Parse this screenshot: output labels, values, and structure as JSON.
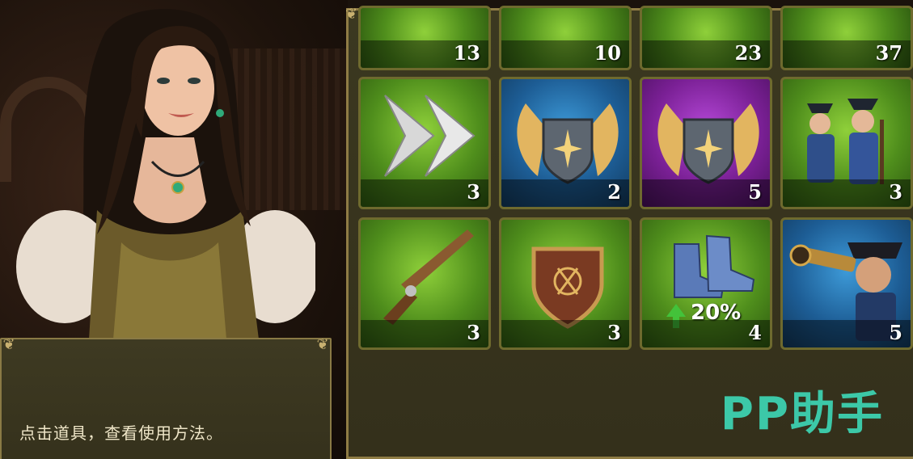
{
  "dialog": {
    "text": "点击道具，查看使用方法。"
  },
  "watermark": {
    "text": "PP助手"
  },
  "inventory": {
    "row1": [
      {
        "icon": "item-icon",
        "count": "13"
      },
      {
        "icon": "item-icon",
        "count": "10"
      },
      {
        "icon": "item-icon",
        "count": "23"
      },
      {
        "icon": "item-icon",
        "count": "37"
      }
    ],
    "row2": [
      {
        "icon": "speedup-arrows-icon",
        "count": "3",
        "rarity": "green"
      },
      {
        "icon": "winged-shield-icon",
        "count": "2",
        "rarity": "blue"
      },
      {
        "icon": "winged-shield-icon",
        "count": "5",
        "rarity": "purple"
      },
      {
        "icon": "soldiers-icon",
        "count": "3",
        "rarity": "green"
      }
    ],
    "row3": [
      {
        "icon": "flintlock-pistol-icon",
        "count": "3",
        "rarity": "green"
      },
      {
        "icon": "crest-shield-icon",
        "count": "3",
        "rarity": "green"
      },
      {
        "icon": "boots-speed-icon",
        "count": "4",
        "rarity": "green",
        "boost": "20%"
      },
      {
        "icon": "captain-telescope-icon",
        "count": "5",
        "rarity": "blue"
      }
    ]
  },
  "colors": {
    "green": "#4f8e1c",
    "blue": "#1d5d95",
    "purple": "#7a2095",
    "border": "#8f7c45"
  }
}
